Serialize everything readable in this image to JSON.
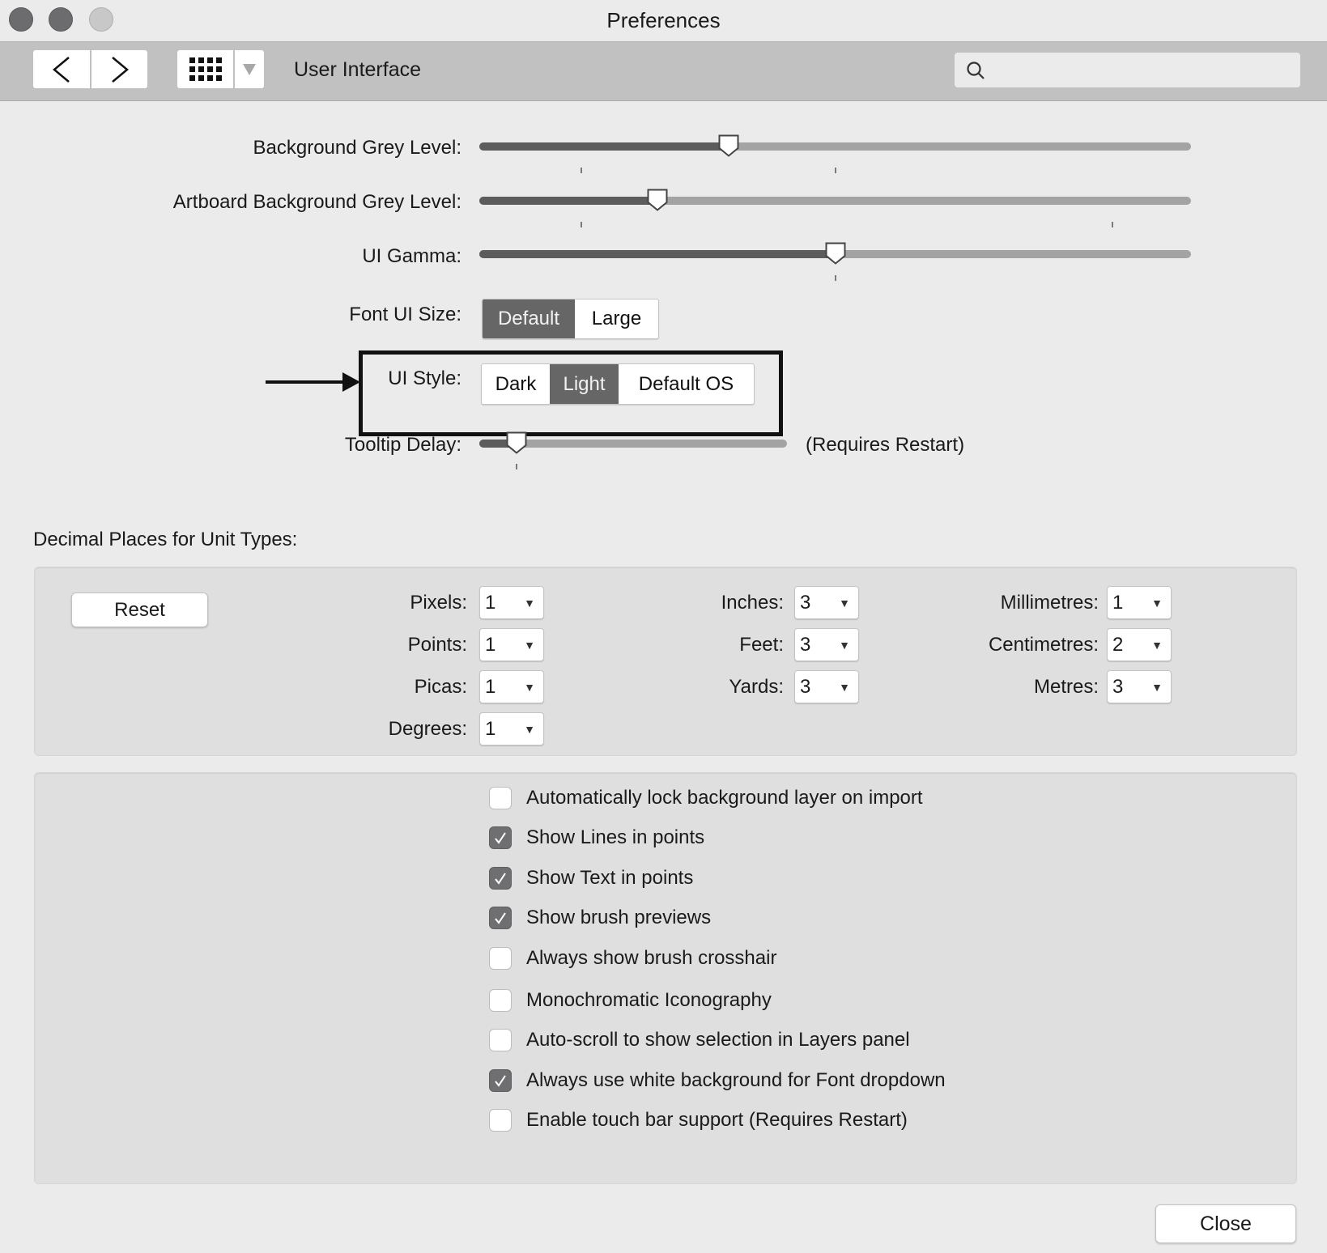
{
  "window": {
    "title": "Preferences"
  },
  "toolbar": {
    "back_icon": "chevron-left-icon",
    "forward_icon": "chevron-right-icon",
    "grid_icon": "grid-icon",
    "dropdown_icon": "triangle-down-icon",
    "section_title": "User Interface",
    "search": {
      "value": "",
      "placeholder": "",
      "icon": "search-icon"
    }
  },
  "sliders": {
    "background_grey": {
      "label": "Background Grey Level:",
      "value": 0.35
    },
    "artboard_grey": {
      "label": "Artboard Background Grey Level:",
      "value": 0.25
    },
    "ui_gamma": {
      "label": "UI Gamma:",
      "value": 0.5
    },
    "tooltip_delay": {
      "label": "Tooltip Delay:",
      "value": 0.12,
      "note": "(Requires Restart)"
    }
  },
  "font_ui_size": {
    "label": "Font UI Size:",
    "options": [
      "Default",
      "Large"
    ],
    "selected": "Default"
  },
  "ui_style": {
    "label": "UI Style:",
    "options": [
      "Dark",
      "Light",
      "Default OS"
    ],
    "selected": "Light"
  },
  "decimal_places": {
    "header": "Decimal Places for Unit Types:",
    "reset_label": "Reset",
    "units": [
      {
        "label": "Pixels:",
        "value": "1"
      },
      {
        "label": "Points:",
        "value": "1"
      },
      {
        "label": "Picas:",
        "value": "1"
      },
      {
        "label": "Degrees:",
        "value": "1"
      },
      {
        "label": "Inches:",
        "value": "3"
      },
      {
        "label": "Feet:",
        "value": "3"
      },
      {
        "label": "Yards:",
        "value": "3"
      },
      {
        "label": "Millimetres:",
        "value": "1"
      },
      {
        "label": "Centimetres:",
        "value": "2"
      },
      {
        "label": "Metres:",
        "value": "3"
      }
    ]
  },
  "options": [
    {
      "label": "Automatically lock background layer on import",
      "checked": false
    },
    {
      "label": "Show Lines in points",
      "checked": true
    },
    {
      "label": "Show Text in points",
      "checked": true
    },
    {
      "label": "Show brush previews",
      "checked": true
    },
    {
      "label": "Always show brush crosshair",
      "checked": false
    },
    {
      "label": "Monochromatic Iconography",
      "checked": false
    },
    {
      "label": "Auto-scroll to show selection in Layers panel",
      "checked": false
    },
    {
      "label": "Always use white background for Font dropdown",
      "checked": true
    },
    {
      "label": "Enable touch bar support (Requires Restart)",
      "checked": false
    }
  ],
  "footer": {
    "close_label": "Close"
  },
  "colors": {
    "accent_selected": "#666666",
    "slider_fill": "#5c5c5c",
    "slider_track": "#a3a3a3",
    "checkbox_checked": "#6f6f72"
  }
}
